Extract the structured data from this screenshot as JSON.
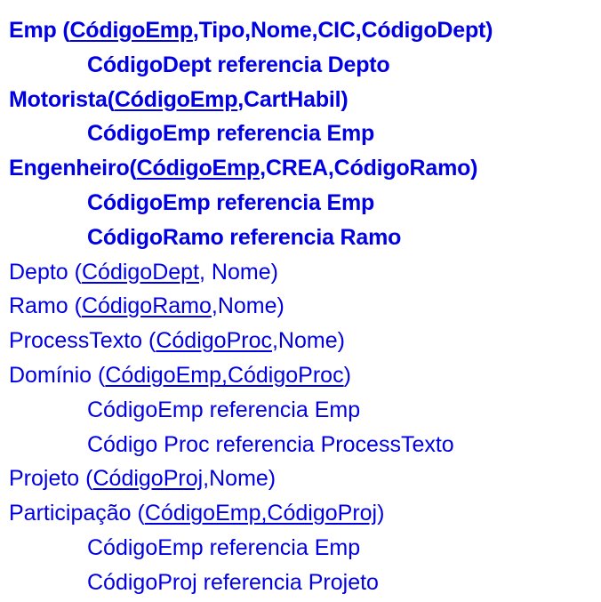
{
  "lines": [
    {
      "kind": "rel",
      "bold": true,
      "parts": [
        {
          "t": "Emp (",
          "u": false
        },
        {
          "t": "CódigoEmp",
          "u": true
        },
        {
          "t": ",Tipo,Nome,CIC,CódigoDept)",
          "u": false
        }
      ]
    },
    {
      "kind": "fk",
      "bold": true,
      "parts": [
        {
          "t": "CódigoDept referencia Depto",
          "u": false
        }
      ]
    },
    {
      "kind": "rel",
      "bold": true,
      "parts": [
        {
          "t": "Motorista(",
          "u": false
        },
        {
          "t": "CódigoEmp",
          "u": true
        },
        {
          "t": ",CartHabil)",
          "u": false
        }
      ]
    },
    {
      "kind": "fk",
      "bold": true,
      "parts": [
        {
          "t": "CódigoEmp referencia Emp",
          "u": false
        }
      ]
    },
    {
      "kind": "rel",
      "bold": true,
      "parts": [
        {
          "t": "Engenheiro(",
          "u": false
        },
        {
          "t": "CódigoEmp",
          "u": true
        },
        {
          "t": ",CREA,CódigoRamo)",
          "u": false
        }
      ]
    },
    {
      "kind": "fk",
      "bold": true,
      "parts": [
        {
          "t": "CódigoEmp referencia Emp",
          "u": false
        }
      ]
    },
    {
      "kind": "fk",
      "bold": true,
      "parts": [
        {
          "t": "CódigoRamo referencia Ramo",
          "u": false
        }
      ]
    },
    {
      "kind": "rel",
      "bold": false,
      "parts": [
        {
          "t": "Depto (",
          "u": false
        },
        {
          "t": "CódigoDept",
          "u": true
        },
        {
          "t": ", Nome)",
          "u": false
        }
      ]
    },
    {
      "kind": "rel",
      "bold": false,
      "parts": [
        {
          "t": "Ramo (",
          "u": false
        },
        {
          "t": "CódigoRamo",
          "u": true
        },
        {
          "t": ",Nome)",
          "u": false
        }
      ]
    },
    {
      "kind": "rel",
      "bold": false,
      "parts": [
        {
          "t": "ProcessTexto (",
          "u": false
        },
        {
          "t": "CódigoProc",
          "u": true
        },
        {
          "t": ",Nome)",
          "u": false
        }
      ]
    },
    {
      "kind": "rel",
      "bold": false,
      "parts": [
        {
          "t": "Domínio (",
          "u": false
        },
        {
          "t": "CódigoEmp,CódigoProc",
          "u": true
        },
        {
          "t": ")",
          "u": false
        }
      ]
    },
    {
      "kind": "fk",
      "bold": false,
      "parts": [
        {
          "t": "CódigoEmp referencia Emp",
          "u": false
        }
      ]
    },
    {
      "kind": "fk",
      "bold": false,
      "parts": [
        {
          "t": "Código Proc referencia ProcessTexto",
          "u": false
        }
      ]
    },
    {
      "kind": "rel",
      "bold": false,
      "parts": [
        {
          "t": "Projeto (",
          "u": false
        },
        {
          "t": "CódigoProj",
          "u": true
        },
        {
          "t": ",Nome)",
          "u": false
        }
      ]
    },
    {
      "kind": "rel",
      "bold": false,
      "parts": [
        {
          "t": "Participação (",
          "u": false
        },
        {
          "t": "CódigoEmp,CódigoProj",
          "u": true
        },
        {
          "t": ")",
          "u": false
        }
      ]
    },
    {
      "kind": "fk",
      "bold": false,
      "parts": [
        {
          "t": "CódigoEmp referencia Emp",
          "u": false
        }
      ]
    },
    {
      "kind": "fk",
      "bold": false,
      "parts": [
        {
          "t": "CódigoProj referencia Projeto",
          "u": false
        }
      ]
    }
  ]
}
